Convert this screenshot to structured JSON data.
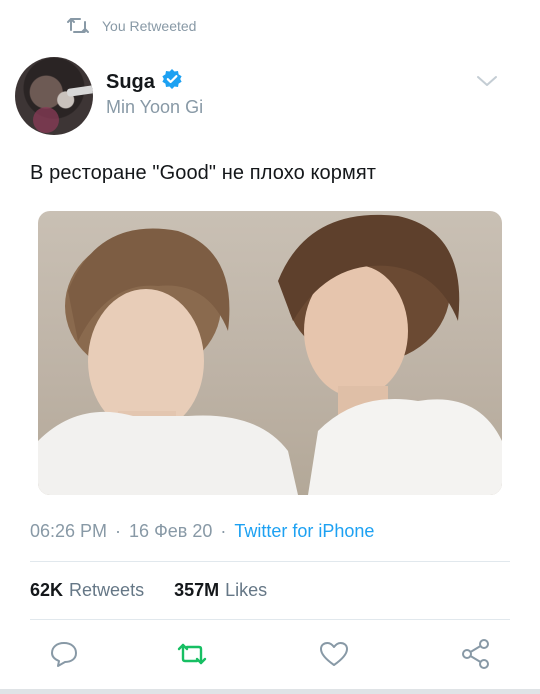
{
  "context": {
    "label": "You Retweeted"
  },
  "author": {
    "name": "Suga",
    "handle": "Min Yoon Gi",
    "verified": true
  },
  "tweet": {
    "text": "В ресторане \"Good\" не плохо кормят",
    "time": "06:26 PM",
    "date": "16 Фев 20",
    "source": "Twitter for iPhone",
    "separator": "·"
  },
  "stats": {
    "retweets_count": "62K",
    "retweets_label": "Retweets",
    "likes_count": "357M",
    "likes_label": "Likes"
  },
  "icons": {
    "reply": "reply-icon",
    "retweet": "retweet-icon",
    "like": "heart-icon",
    "share": "share-icon",
    "menu": "chevron-down-icon",
    "verified": "verified-badge-icon"
  },
  "colors": {
    "accent": "#1da1f2",
    "retweeted": "#17bf63",
    "muted": "#8899a6",
    "text": "#14171a"
  }
}
